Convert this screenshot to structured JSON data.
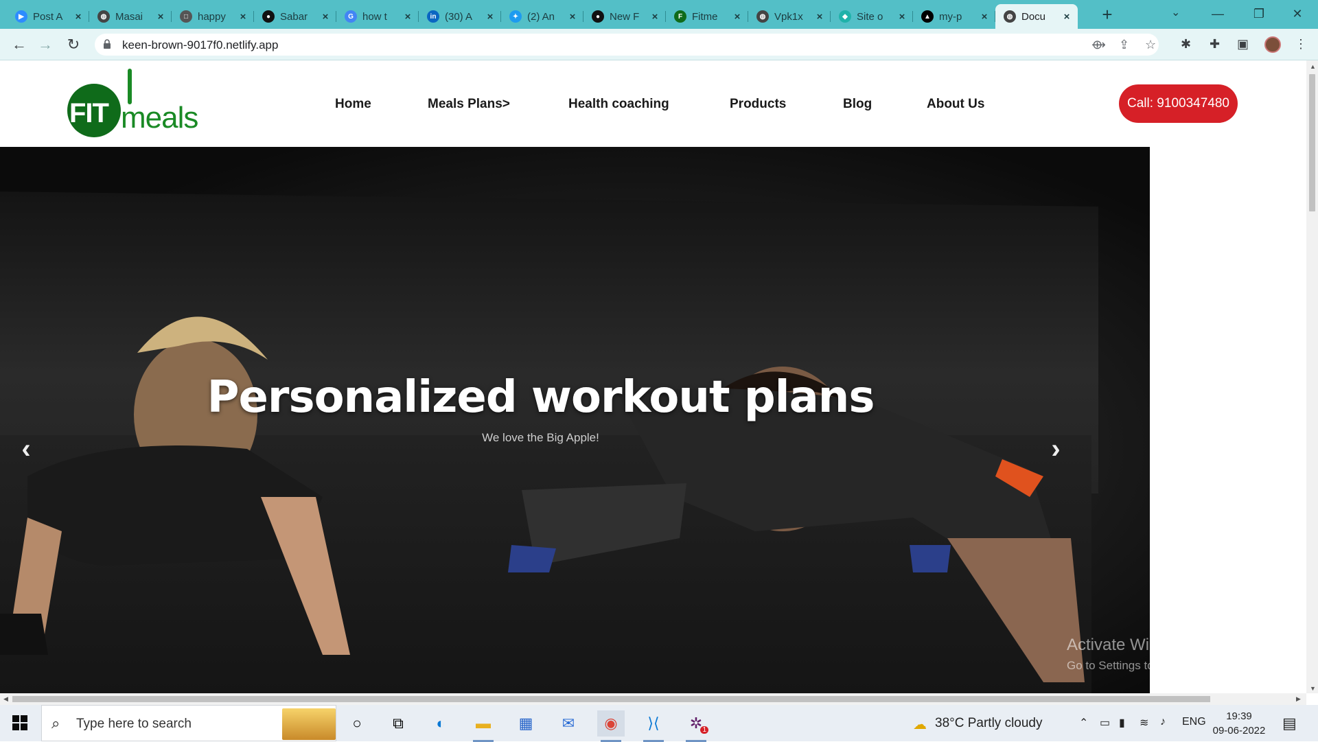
{
  "browser": {
    "tabs": [
      {
        "title": "Post A",
        "favicon": "zoom-icon",
        "color": "#2d8cff",
        "glyph": "▶"
      },
      {
        "title": "Masai",
        "favicon": "globe-icon",
        "color": "#444",
        "glyph": "◍"
      },
      {
        "title": "happy",
        "favicon": "square-icon",
        "color": "#555",
        "glyph": "□"
      },
      {
        "title": "Sabar",
        "favicon": "github-icon",
        "color": "#111",
        "glyph": "●"
      },
      {
        "title": "how t",
        "favicon": "google-icon",
        "color": "#4285f4",
        "glyph": "G"
      },
      {
        "title": "(30) A",
        "favicon": "linkedin-icon",
        "color": "#0a66c2",
        "glyph": "in"
      },
      {
        "title": "(2) An",
        "favicon": "twitter-icon",
        "color": "#1d9bf0",
        "glyph": "✦"
      },
      {
        "title": "New F",
        "favicon": "github-icon",
        "color": "#111",
        "glyph": "●"
      },
      {
        "title": "Fitme",
        "favicon": "fitmeals-icon",
        "color": "#0f6b1a",
        "glyph": "F"
      },
      {
        "title": "Vpk1x",
        "favicon": "globe-icon",
        "color": "#444",
        "glyph": "◍"
      },
      {
        "title": "Site o",
        "favicon": "netlify-icon",
        "color": "#20b2aa",
        "glyph": "◆"
      },
      {
        "title": "my-p",
        "favicon": "vercel-icon",
        "color": "#000",
        "glyph": "▲"
      },
      {
        "title": "Docu",
        "favicon": "globe-icon",
        "color": "#444",
        "glyph": "◍"
      }
    ],
    "active_tab": 12,
    "url": "keen-brown-9017f0.netlify.app"
  },
  "site": {
    "logo": {
      "fit": "FIT",
      "meals": "meals"
    },
    "nav": [
      "Home",
      "Meals Plans>",
      "Health coaching",
      "Products",
      "Blog",
      "About Us"
    ],
    "call_button": "Call: 9100347480",
    "brand_color": "#d62027",
    "hero": {
      "title": "Personalized workout plans",
      "subtitle": "We love the Big Apple!",
      "prev_icon": "chevron-left-icon",
      "next_icon": "chevron-right-icon"
    }
  },
  "watermark": {
    "line1": "Activate Windows",
    "line2": "Go to Settings to activate Windows."
  },
  "taskbar": {
    "search_placeholder": "Type here to search",
    "weather": "38°C  Partly cloudy",
    "language": "ENG",
    "time": "19:39",
    "date": "09-06-2022",
    "slack_badge": "1"
  }
}
